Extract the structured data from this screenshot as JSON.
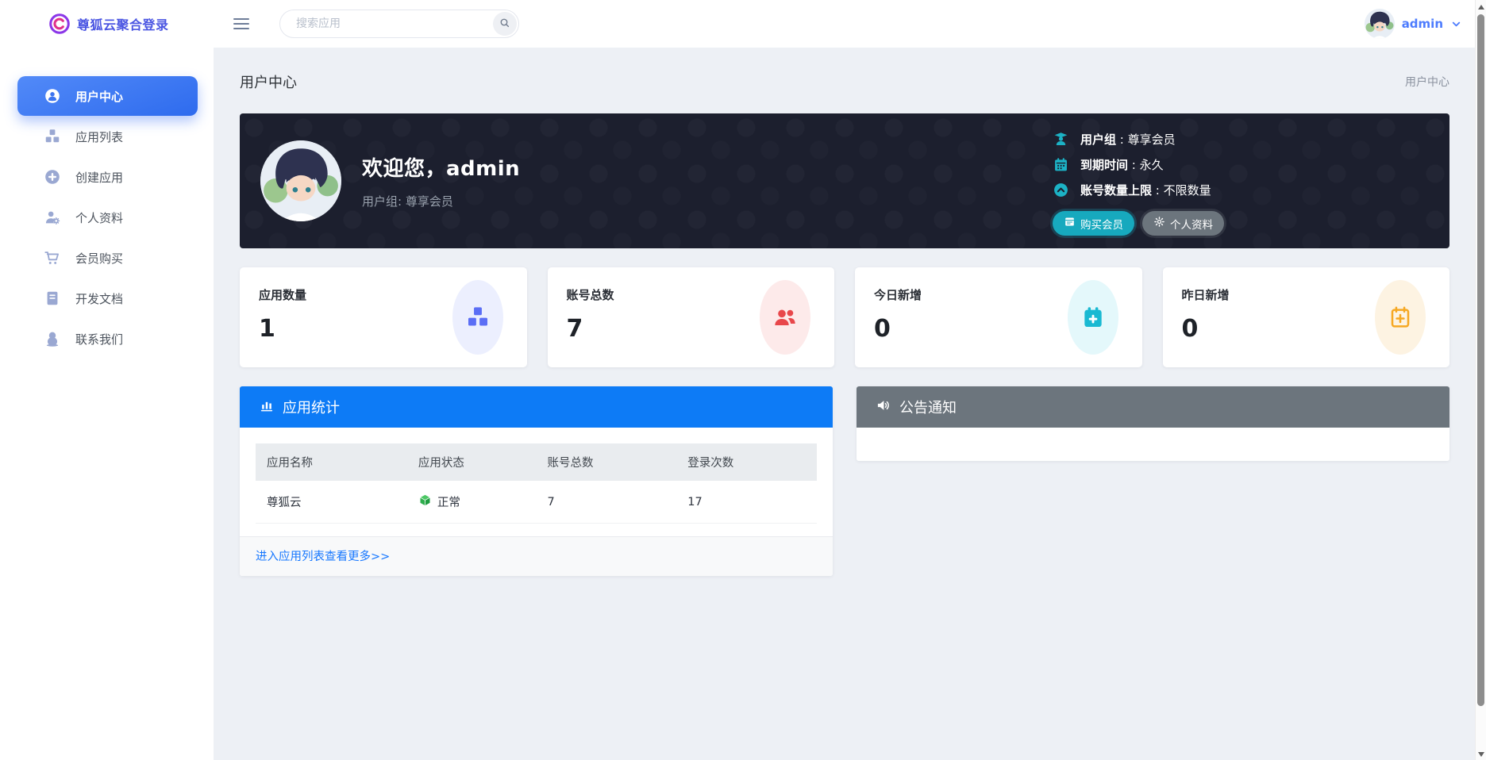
{
  "header": {
    "logo_text": "尊狐云聚合登录",
    "search_placeholder": "搜索应用",
    "username": "admin"
  },
  "sidebar": {
    "items": [
      {
        "label": "用户中心",
        "icon": "user-circle-icon",
        "active": true
      },
      {
        "label": "应用列表",
        "icon": "cubes-icon",
        "active": false
      },
      {
        "label": "创建应用",
        "icon": "plus-circle-icon",
        "active": false
      },
      {
        "label": "个人资料",
        "icon": "user-gear-icon",
        "active": false
      },
      {
        "label": "会员购买",
        "icon": "cart-icon",
        "active": false
      },
      {
        "label": "开发文档",
        "icon": "book-icon",
        "active": false
      },
      {
        "label": "联系我们",
        "icon": "qq-icon",
        "active": false
      }
    ]
  },
  "page": {
    "title": "用户中心",
    "breadcrumb": "用户中心"
  },
  "hero": {
    "welcome": "欢迎您，admin",
    "subtitle": "用户组: 尊享会员",
    "separator": " : ",
    "info": [
      {
        "label": "用户组",
        "value": "尊享会员",
        "icon": "graduate-user-icon"
      },
      {
        "label": "到期时间",
        "value": "永久",
        "icon": "calendar-icon"
      },
      {
        "label": "账号数量上限",
        "value": "不限数量",
        "icon": "arrow-up-circle-icon"
      }
    ],
    "buttons": [
      {
        "label": "购买会员",
        "icon": "passbook-icon",
        "color": "#17a9be"
      },
      {
        "label": "个人资料",
        "icon": "gear-icon",
        "color": "#6c757d"
      }
    ]
  },
  "stats": [
    {
      "label": "应用数量",
      "value": "1",
      "icon": "cubes-icon",
      "color": "#5b6ef5",
      "bg": "#eceffe"
    },
    {
      "label": "账号总数",
      "value": "7",
      "icon": "users-icon",
      "color": "#e8474b",
      "bg": "#fdeaea"
    },
    {
      "label": "今日新增",
      "value": "0",
      "icon": "calendar-plus-icon",
      "color": "#19b9d2",
      "bg": "#e4f8fb"
    },
    {
      "label": "昨日新增",
      "value": "0",
      "icon": "calendar-plus-outline-icon",
      "color": "#f6a823",
      "bg": "#fdf3e2"
    }
  ],
  "app_stats": {
    "title": "应用统计",
    "headers": [
      "应用名称",
      "应用状态",
      "账号总数",
      "登录次数"
    ],
    "rows": [
      {
        "name": "尊狐云",
        "status": "正常",
        "accounts": "7",
        "logins": "17"
      }
    ],
    "more_link": "进入应用列表查看更多>>"
  },
  "notice": {
    "title": "公告通知"
  },
  "colors": {
    "primary_blue": "#0d7bf6",
    "sidebar_active_gradient": [
      "#528af8",
      "#2e6bee"
    ],
    "teal": "#17a9be",
    "header_gray": "#6c757d",
    "link_blue": "#1677ff",
    "status_green": "#2fae4d",
    "banner_bg": "#1c1f2e"
  }
}
